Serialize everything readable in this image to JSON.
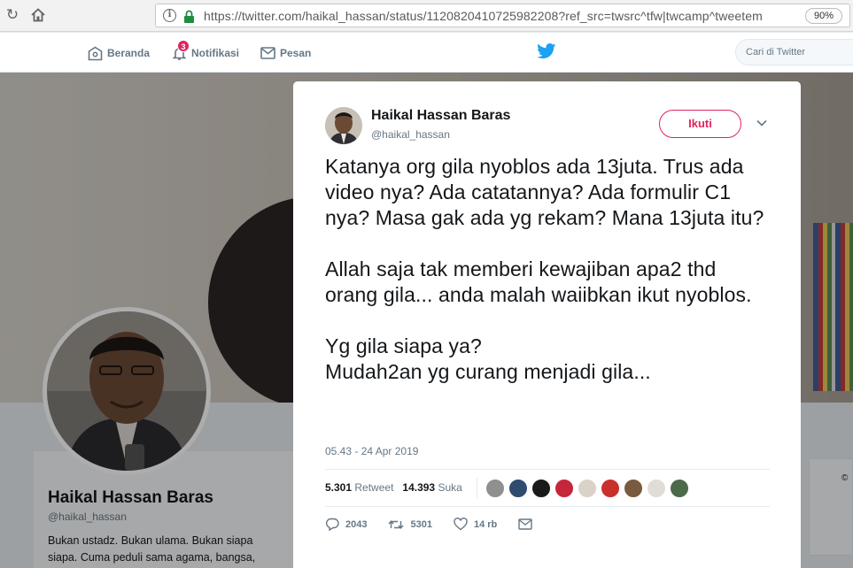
{
  "browser": {
    "url": "https://twitter.com/haikal_hassan/status/1120820410725982208?ref_src=twsrc^tfw|twcamp^tweetem",
    "zoom": "90%"
  },
  "nav": {
    "home": "Beranda",
    "notifications": "Notifikasi",
    "notif_count": "3",
    "messages": "Pesan",
    "search_placeholder": "Cari di Twitter"
  },
  "profile": {
    "name": "Haikal Hassan Baras",
    "handle": "@haikal_hassan",
    "bio": "Bukan ustadz. Bukan ulama. Bukan siapa siapa. Cuma peduli sama agama, bangsa,"
  },
  "tweet": {
    "name": "Haikal Hassan Baras",
    "handle": "@haikal_hassan",
    "follow_label": "Ikuti",
    "text": "Katanya org gila nyoblos ada 13juta. Trus ada video nya? Ada catatannya? Ada formulir C1 nya? Masa gak ada yg rekam? Mana 13juta itu?\n\nAllah saja tak memberi kewajiban apa2 thd orang gila... anda malah waiibkan ikut nyoblos.\n\nYg gila siapa ya?\nMudah2an yg curang menjadi gila...",
    "timestamp": "05.43 - 24 Apr 2019",
    "retweet_count": "5.301",
    "retweet_label": "Retweet",
    "like_count": "14.393",
    "like_label": "Suka",
    "reply_action": "2043",
    "retweet_action": "5301",
    "like_action": "14 rb"
  },
  "colors": {
    "accent": "#e0245e",
    "twitter_blue": "#1da1f2",
    "muted": "#657786"
  }
}
